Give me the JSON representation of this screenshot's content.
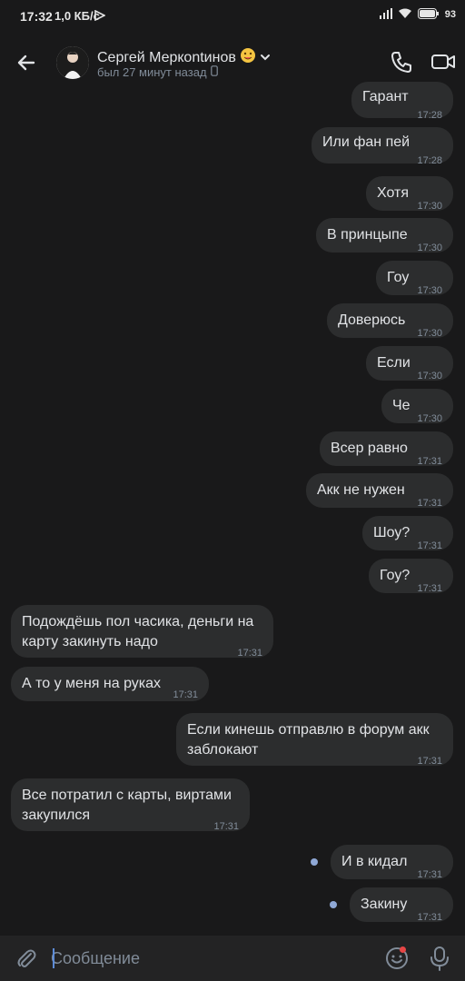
{
  "status_bar": {
    "time": "17:32",
    "speed": "1,0 КБ/с",
    "battery": "93"
  },
  "header": {
    "name": "Сергей Меркontинов",
    "status": "был 27 минут назад"
  },
  "messages": [
    {
      "dir": "out",
      "text": "Гарант",
      "time": "17:28"
    },
    {
      "dir": "out",
      "text": "Или фан пей",
      "time": "17:28"
    },
    {
      "dir": "out",
      "text": "Хотя",
      "time": "17:30"
    },
    {
      "dir": "out",
      "text": "В принцыпе",
      "time": "17:30"
    },
    {
      "dir": "out",
      "text": "Гоу",
      "time": "17:30"
    },
    {
      "dir": "out",
      "text": "Доверюсь",
      "time": "17:30"
    },
    {
      "dir": "out",
      "text": "Если",
      "time": "17:30"
    },
    {
      "dir": "out",
      "text": "Че",
      "time": "17:30"
    },
    {
      "dir": "out",
      "text": "Всер равно",
      "time": "17:31"
    },
    {
      "dir": "out",
      "text": "Акк не нужен",
      "time": "17:31"
    },
    {
      "dir": "out",
      "text": "Шоу?",
      "time": "17:31"
    },
    {
      "dir": "out",
      "text": "Гоу?",
      "time": "17:31"
    },
    {
      "dir": "in",
      "text": "Подождёшь пол часика, деньги на карту закинуть надо",
      "time": "17:31"
    },
    {
      "dir": "in",
      "text": "А то у меня на руках",
      "time": "17:31"
    },
    {
      "dir": "out",
      "text": "Если  кинешь отправлю в форум акк заблокают",
      "time": "17:31"
    },
    {
      "dir": "in",
      "text": "Все потратил с карты, виртами закупился",
      "time": "17:31"
    },
    {
      "dir": "out",
      "text": "И в кидал",
      "time": "17:31",
      "unread": true
    },
    {
      "dir": "out",
      "text": "Закину",
      "time": "17:31",
      "unread": true
    }
  ],
  "composer": {
    "placeholder": "Сообщение"
  },
  "icons": {
    "back": "arrow-left-icon",
    "call": "phone-icon",
    "video": "video-camera-icon",
    "attach": "paperclip-icon",
    "emoji": "smile-icon",
    "mic": "microphone-icon"
  },
  "colors": {
    "background": "#19191a",
    "bubble": "#2c2d2e",
    "text": "#e1e3e6",
    "secondary": "#818c99",
    "unread_dot": "#8fa8d6"
  }
}
